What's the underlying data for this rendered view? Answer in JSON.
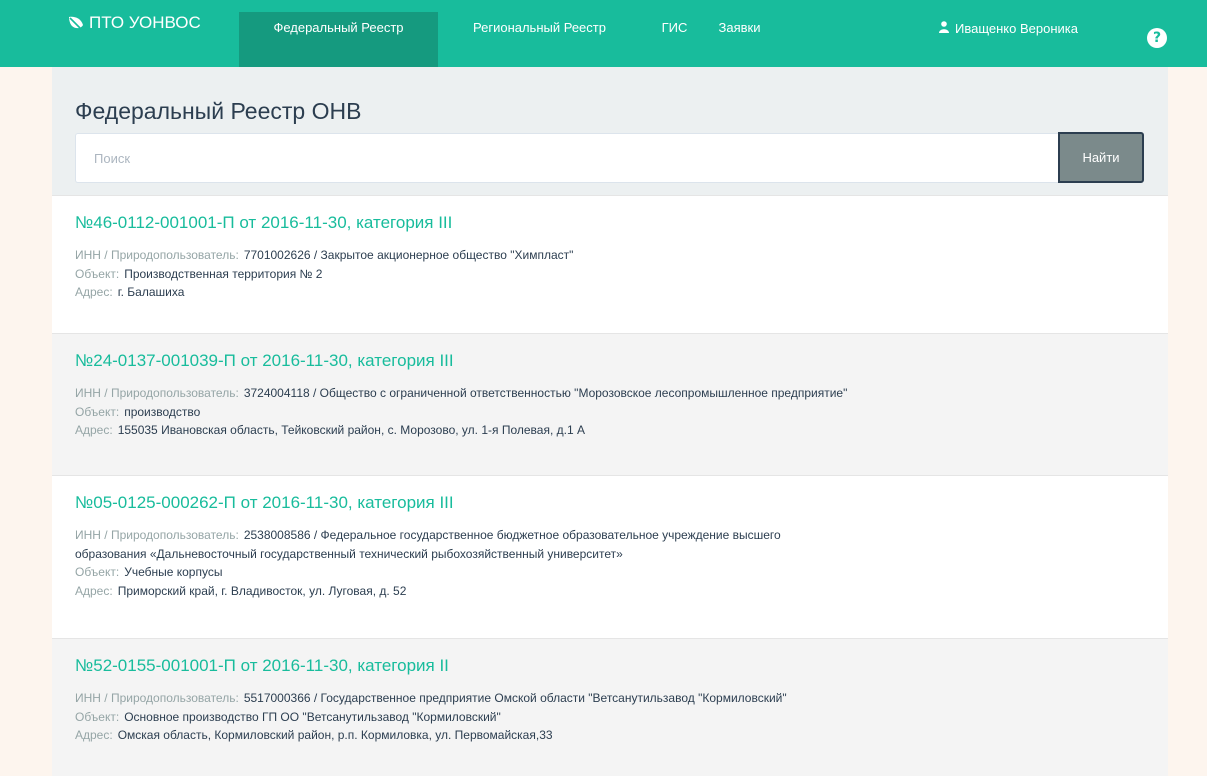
{
  "navbar": {
    "brand": "ПТО УОНВОС",
    "items": [
      "Федеральный Реестр",
      "Региональный Реестр",
      "ГИС",
      "Заявки"
    ],
    "user": "Иващенко Вероника",
    "help": "?"
  },
  "page": {
    "title": "Федеральный Реестр ОНВ",
    "search_placeholder": "Поиск",
    "search_value": "",
    "search_button": "Найти"
  },
  "labels": {
    "inn": "ИНН / Природопользователь:",
    "object": "Объект:",
    "address": "Адрес:"
  },
  "results": [
    {
      "title": "№46-0112-001001-П от 2016-11-30, категория III",
      "inn_lines": [
        "7701002626 / Закрытое акционерное общество \"Химпласт\""
      ],
      "object": "Производственная территория № 2",
      "address": "г. Балашиха"
    },
    {
      "title": "№24-0137-001039-П от 2016-11-30, категория III",
      "inn_lines": [
        "3724004118 / Общество с ограниченной ответственностью \"Морозовское лесопромышленное предприятие\""
      ],
      "object": "производство",
      "address": "155035 Ивановская область, Тейковский район, с. Морозово, ул. 1-я Полевая, д.1 А"
    },
    {
      "title": "№05-0125-000262-П от 2016-11-30, категория III",
      "inn_lines": [
        "2538008586 / Федеральное государственное бюджетное образовательное учреждение высшего",
        "образования «Дальневосточный государственный технический рыбохозяйственный университет»"
      ],
      "object": "Учебные корпусы",
      "address": "Приморский край, г. Владивосток, ул. Луговая, д. 52"
    },
    {
      "title": "№52-0155-001001-П от 2016-11-30, категория II",
      "inn_lines": [
        "5517000366 / Государственное предприятие Омской области \"Ветсанутильзавод \"Кормиловский\""
      ],
      "object": "Основное производство ГП ОО \"Ветсанутильзавод \"Кормиловский\"",
      "address": "Омская область, Кормиловский район, р.п. Кормиловка, ул. Первомайская,33"
    }
  ]
}
